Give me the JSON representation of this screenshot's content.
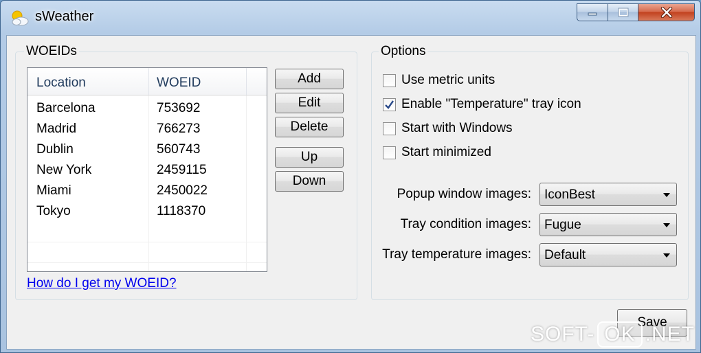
{
  "window": {
    "title": "sWeather"
  },
  "woeids_group": {
    "label": "WOEIDs",
    "columns": [
      "Location",
      "WOEID"
    ],
    "rows": [
      {
        "location": "Barcelona",
        "woeid": "753692"
      },
      {
        "location": "Madrid",
        "woeid": "766273"
      },
      {
        "location": "Dublin",
        "woeid": "560743"
      },
      {
        "location": "New York",
        "woeid": "2459115"
      },
      {
        "location": "Miami",
        "woeid": "2450022"
      },
      {
        "location": "Tokyo",
        "woeid": "1118370"
      }
    ],
    "buttons": {
      "add": "Add",
      "edit": "Edit",
      "delete": "Delete",
      "up": "Up",
      "down": "Down"
    },
    "help_link": "How do I get my WOEID?"
  },
  "options_group": {
    "label": "Options",
    "checkboxes": [
      {
        "label": "Use metric units",
        "checked": false
      },
      {
        "label": "Enable \"Temperature\" tray icon",
        "checked": true
      },
      {
        "label": "Start with Windows",
        "checked": false
      },
      {
        "label": "Start minimized",
        "checked": false
      }
    ],
    "selects": [
      {
        "label": "Popup window images:",
        "value": "IconBest"
      },
      {
        "label": "Tray condition images:",
        "value": "Fugue"
      },
      {
        "label": "Tray temperature images:",
        "value": "Default"
      }
    ]
  },
  "save_label": "Save",
  "watermark": {
    "left": "SOFT-",
    "box": "OK",
    "right": ".NET"
  },
  "icons": {
    "app": "weather-sun-cloud-icon",
    "minimize": "minimize-icon",
    "maximize": "maximize-icon",
    "close": "close-icon",
    "dropdown": "chevron-down-icon",
    "check": "checkmark-icon"
  },
  "colors": {
    "link": "#0000ee",
    "close_button": "#c2411e",
    "titlebar": "#b3cbe6"
  }
}
